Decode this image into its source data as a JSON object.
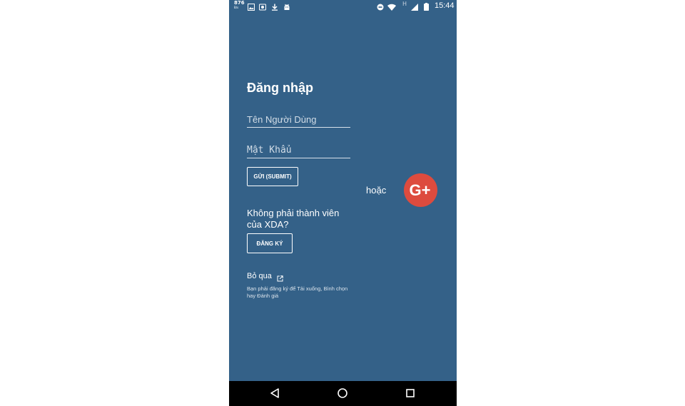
{
  "status_bar": {
    "network_speed": "876",
    "network_speed_unit": "B/s",
    "signal_type": "H",
    "time": "15:44",
    "left_icons": [
      "image-icon",
      "screenshot-icon",
      "download-icon",
      "android-icon"
    ],
    "right_icons": [
      "do-not-disturb-icon",
      "wifi-icon",
      "signal-icon",
      "battery-icon"
    ]
  },
  "login": {
    "title": "Đăng nhập",
    "username_placeholder": "Tên Người Dùng",
    "username_value": "",
    "password_placeholder": "Mật Khẩu",
    "password_value": "",
    "submit_label": "GỬI (SUBMIT)",
    "or_label": "hoặc",
    "google_plus_label": "G+"
  },
  "signup": {
    "prompt": "Không phải thành viên của XDA?",
    "button_label": "ĐĂNG KÝ"
  },
  "skip": {
    "label": "Bỏ qua",
    "note": "Bạn phải đăng ký để Tải xuống, Bình chọn hay Đánh giá"
  },
  "nav_bar": {
    "buttons": [
      "back-icon",
      "home-icon",
      "recents-icon"
    ]
  },
  "colors": {
    "background": "#346188",
    "google_plus": "#dd4b3e",
    "nav_bar": "#000000",
    "text": "#ffffff"
  }
}
